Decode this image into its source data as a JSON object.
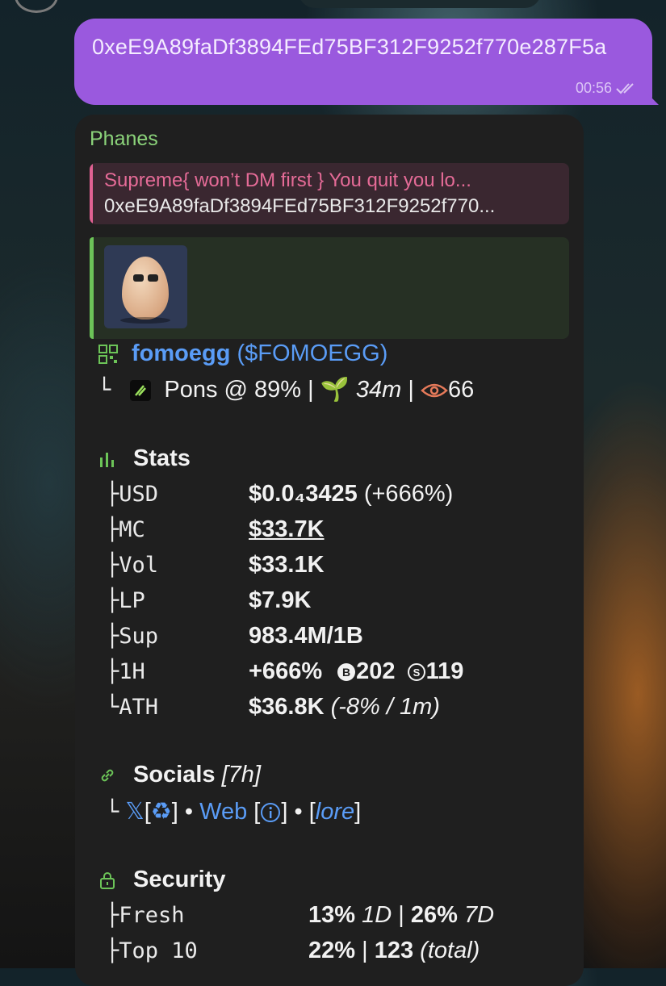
{
  "outgoing_message": {
    "text": "0xeE9A89faDf3894FEd75BF312F9252f770e287F5a",
    "time": "00:56"
  },
  "incoming_message": {
    "sender": "Phanes",
    "reply": {
      "title": "Supreme{ won’t DM first } You quit you lo...",
      "text": "0xeE9A89faDf3894FEd75BF312F9252f770..."
    },
    "token": {
      "name": "fomoegg",
      "ticker": "($FOMOEGG)",
      "branch": "└",
      "platform": "Pons @ 89% |",
      "age": "34m",
      "separator": "|",
      "views": "66"
    },
    "stats": {
      "title": "Stats",
      "rows": [
        {
          "branch": "├",
          "label": "USD",
          "value": "$0.0₄3425",
          "extra": "(+666%)"
        },
        {
          "branch": "├",
          "label": "MC",
          "value": "$33.7K"
        },
        {
          "branch": "├",
          "label": "Vol",
          "value": "$33.1K"
        },
        {
          "branch": "├",
          "label": "LP",
          "value": "$7.9K"
        },
        {
          "branch": "├",
          "label": "Sup",
          "value": "983.4M/1B"
        },
        {
          "branch": "├",
          "label": "1H",
          "value": "+666%",
          "buys": "202",
          "sells": "119"
        },
        {
          "branch": "└",
          "label": "ATH",
          "value": "$36.8K",
          "extra": "(-8% / 1m)"
        }
      ]
    },
    "socials": {
      "title": "Socials",
      "age": "[7h]",
      "branch": "└",
      "x_link": "𝕏",
      "x_bracket_open": "[",
      "x_bracket_close": "]",
      "dot1": "•",
      "web_link": "Web",
      "web_bracket_open": "[",
      "web_bracket_close": "]",
      "dot2": "•",
      "lore_open": "[",
      "lore_link": "lore",
      "lore_close": "]"
    },
    "security": {
      "title": "Security",
      "rows": [
        {
          "branch": "├",
          "label": "Fresh",
          "v1": "13%",
          "v1_tag": "1D",
          "sep": "|",
          "v2": "26%",
          "v2_tag": "7D"
        },
        {
          "branch": "├",
          "label": "Top 10",
          "v1": "22%",
          "sep": "|",
          "v2": "123",
          "v2_tag": "(total)"
        }
      ]
    }
  },
  "colors": {
    "outgoing_bubble": "#9a59de",
    "incoming_bubble": "#1f1f1f",
    "sender_name": "#8bd37a",
    "reply_accent": "#e06192",
    "link": "#5a9cf6",
    "preview_accent": "#6cc458"
  }
}
